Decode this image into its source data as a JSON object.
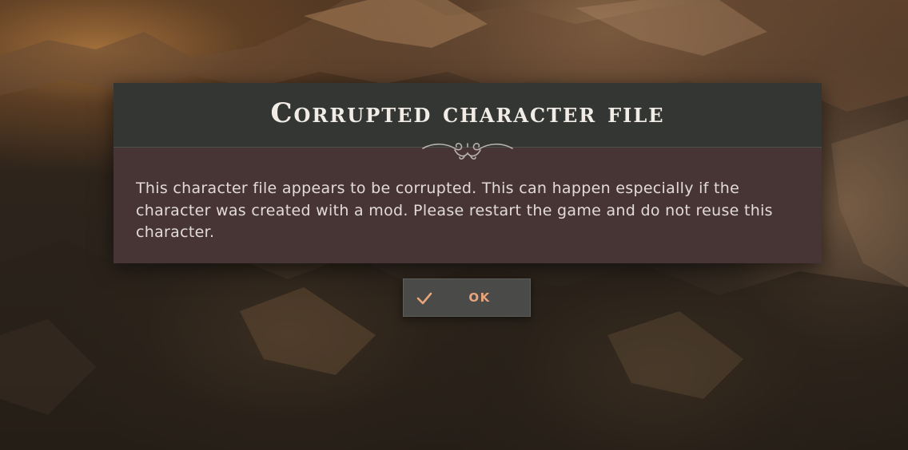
{
  "dialog": {
    "title": "Corrupted character file",
    "message": "This character file appears to be corrupted. This can happen especially if the character was created with a mod. Please restart the game and do not reuse this character."
  },
  "ok_button": {
    "label": "OK",
    "icon": "checkmark-icon"
  },
  "colors": {
    "header_bg": "#333632",
    "body_bg": "#463534",
    "button_bg": "#4a4a48",
    "accent": "#e8a47a",
    "title_text": "#f1ede6",
    "message_text": "#e2dad6"
  }
}
